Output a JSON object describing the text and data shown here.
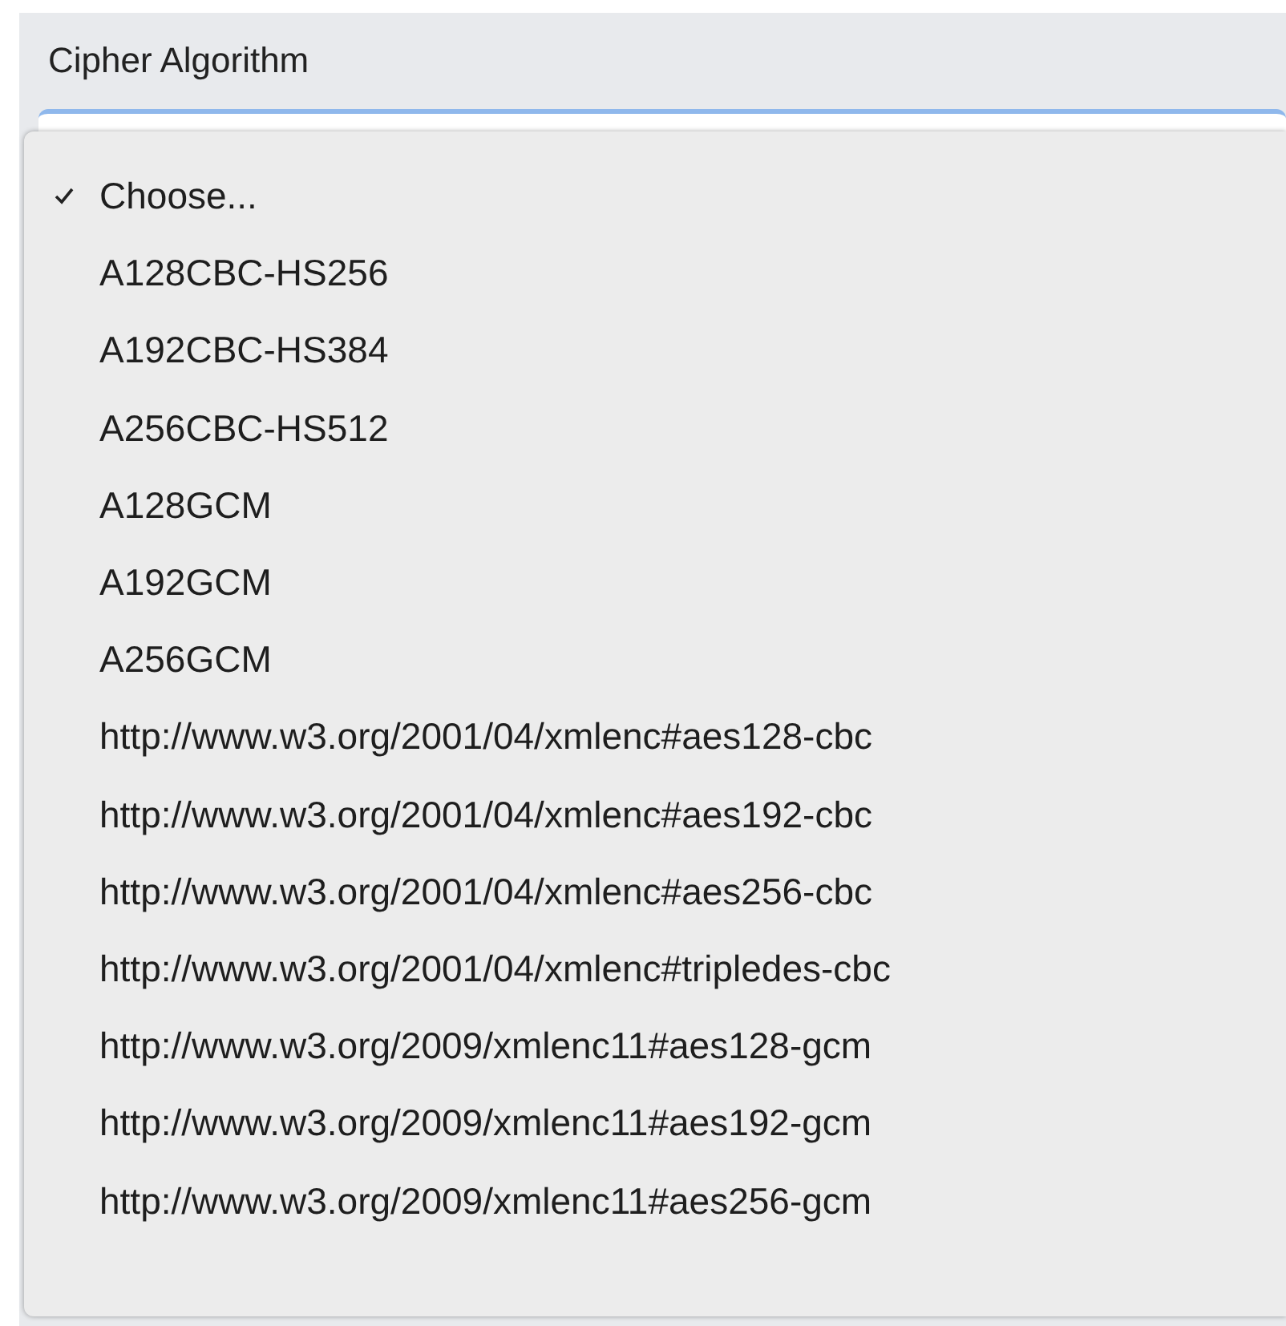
{
  "field": {
    "label": "Cipher Algorithm"
  },
  "menu": {
    "options": [
      {
        "label": "Choose...",
        "selected": true
      },
      {
        "label": "A128CBC-HS256",
        "selected": false
      },
      {
        "label": "A192CBC-HS384",
        "selected": false
      },
      {
        "label": "A256CBC-HS512",
        "selected": false
      },
      {
        "label": "A128GCM",
        "selected": false
      },
      {
        "label": "A192GCM",
        "selected": false
      },
      {
        "label": "A256GCM",
        "selected": false
      },
      {
        "label": "http://www.w3.org/2001/04/xmlenc#aes128-cbc",
        "selected": false
      },
      {
        "label": "http://www.w3.org/2001/04/xmlenc#aes192-cbc",
        "selected": false
      },
      {
        "label": "http://www.w3.org/2001/04/xmlenc#aes256-cbc",
        "selected": false
      },
      {
        "label": "http://www.w3.org/2001/04/xmlenc#tripledes-cbc",
        "selected": false
      },
      {
        "label": "http://www.w3.org/2009/xmlenc11#aes128-gcm",
        "selected": false
      },
      {
        "label": "http://www.w3.org/2009/xmlenc11#aes192-gcm",
        "selected": false
      },
      {
        "label": "http://www.w3.org/2009/xmlenc11#aes256-gcm",
        "selected": false
      }
    ]
  }
}
